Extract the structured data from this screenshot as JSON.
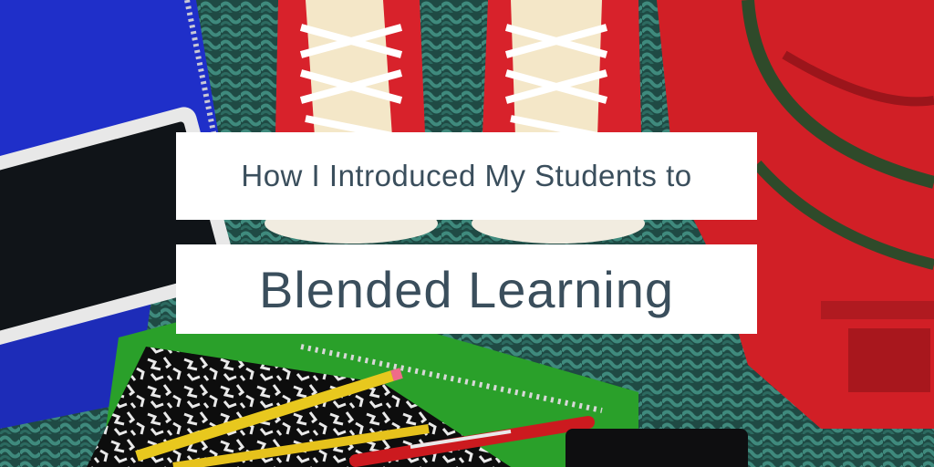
{
  "title": {
    "line1": "How I Introduced My Students to",
    "line2": "Blended Learning"
  },
  "colors": {
    "banner_bg": "#ffffff",
    "title_text": "#3a4e5c",
    "sneaker_red": "#d8222b",
    "backpack_red": "#d11f26",
    "notebook_blue": "#1f2fc9",
    "notebook_green": "#2aa02a",
    "rug_teal": "#2f6b62",
    "pencil_yellow": "#e8c81e"
  }
}
